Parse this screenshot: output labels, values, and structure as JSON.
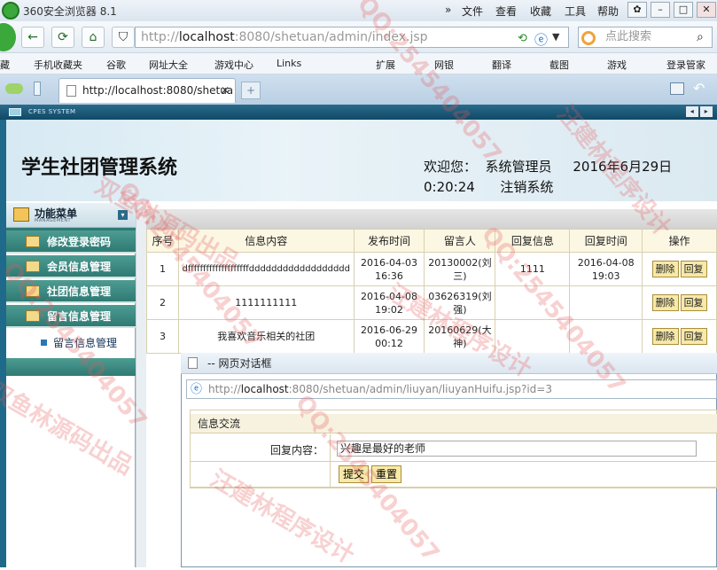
{
  "browser": {
    "title": "360安全浏览器 8.1",
    "menu": [
      "»",
      "文件",
      "查看",
      "收藏",
      "工具",
      "帮助"
    ],
    "address": {
      "prefix": "http://",
      "host": "localhost",
      "rest": ":8080/shetuan/admin/index.jsp"
    },
    "search_placeholder": "点此搜索",
    "favorites": [
      "藏",
      "手机收藏夹",
      "谷歌",
      "网址大全",
      "游戏中心",
      "Links",
      "扩展",
      "网银",
      "翻译",
      "截图",
      "游戏",
      "登录管家"
    ],
    "tab_label": "http://localhost:8080/shetua"
  },
  "app": {
    "strip": "CPES SYSTEM",
    "title": "学生社团管理系统",
    "welcome_line1": "欢迎您：  系统管理员     2016年6月29日",
    "welcome_line2": "0:20:24      注销系统"
  },
  "sidebar": {
    "header": "功能菜单",
    "header_sub": "MANAGEMENT",
    "items": [
      "修改登录密码",
      "会员信息管理",
      "社团信息管理",
      "留言信息管理"
    ],
    "sub_item": "留言信息管理"
  },
  "table": {
    "headers": [
      "序号",
      "信息内容",
      "发布时间",
      "留言人",
      "回复信息",
      "回复时间",
      "操作"
    ],
    "rows": [
      {
        "no": "1",
        "content": "dffffffffffffffffffffdddddddddddddddddd",
        "time": "2016-04-03 16:36",
        "author": "20130002(刘三)",
        "reply": "1111",
        "reply_time": "2016-04-08 19:03"
      },
      {
        "no": "2",
        "content": "1111111111",
        "time": "2016-04-08 19:02",
        "author": "03626319(刘强)",
        "reply": "",
        "reply_time": ""
      },
      {
        "no": "3",
        "content": "我喜欢音乐相关的社团",
        "time": "2016-06-29 00:12",
        "author": "20160629(大神)",
        "reply": "",
        "reply_time": ""
      }
    ],
    "btn_delete": "删除",
    "btn_reply": "回复"
  },
  "dialog": {
    "title": "-- 网页对话框",
    "address": {
      "prefix": "http://",
      "host": "localhost",
      "rest": ":8080/shetuan/admin/liuyan/liuyanHuifu.jsp?id=3"
    },
    "form_header": "信息交流",
    "label": "回复内容：",
    "value": "兴趣是最好的老师",
    "submit": "提交",
    "reset": "重置"
  },
  "watermarks": [
    "QQ:2545404057",
    "汪建林程序设计",
    "双鱼林源码出品"
  ]
}
